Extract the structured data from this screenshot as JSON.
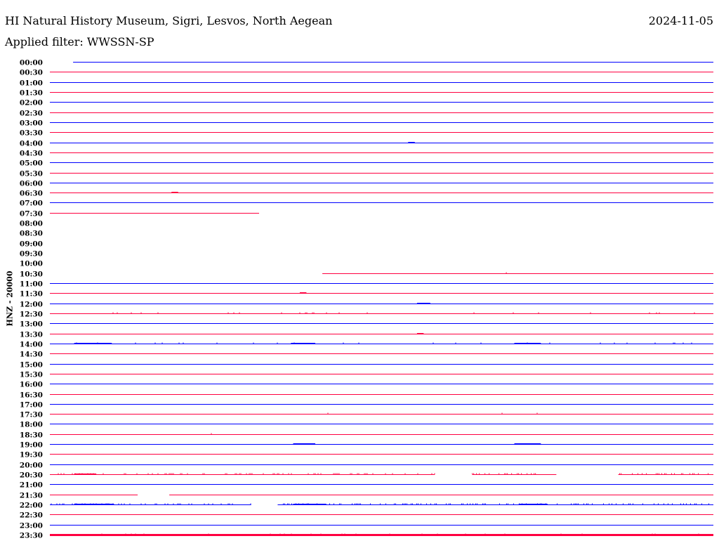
{
  "header": {
    "title": "HI Natural History Museum, Sigri, Lesvos, North Aegean",
    "date": "2024-11-05",
    "filter": "Applied filter: WWSSN-SP"
  },
  "chart_data": {
    "type": "line",
    "title": "HI Natural History Museum, Sigri, Lesvos, North Aegean",
    "ylabel": "HNZ - 20000",
    "x_range_minutes": [
      0,
      30
    ],
    "colors": {
      "even": "#0000ff",
      "odd": "#ff0040"
    },
    "rows": [
      {
        "label": "00:00",
        "segments": [
          [
            1.05,
            30
          ]
        ],
        "noise": 0
      },
      {
        "label": "00:30",
        "segments": [
          [
            0,
            30
          ]
        ],
        "noise": 0
      },
      {
        "label": "01:00",
        "segments": [
          [
            0,
            30
          ]
        ],
        "noise": 0
      },
      {
        "label": "01:30",
        "segments": [
          [
            0,
            30
          ]
        ],
        "noise": 0
      },
      {
        "label": "02:00",
        "segments": [
          [
            0,
            30
          ]
        ],
        "noise": 0
      },
      {
        "label": "02:30",
        "segments": [
          [
            0,
            30
          ]
        ],
        "noise": 0
      },
      {
        "label": "03:00",
        "segments": [
          [
            0,
            30
          ]
        ],
        "noise": 0
      },
      {
        "label": "03:30",
        "segments": [
          [
            0,
            30
          ]
        ],
        "noise": 0
      },
      {
        "label": "04:00",
        "segments": [
          [
            0,
            30
          ]
        ],
        "noise": 0,
        "bursts": [
          [
            16.2,
            16.5
          ]
        ]
      },
      {
        "label": "04:30",
        "segments": [
          [
            0,
            30
          ]
        ],
        "noise": 0
      },
      {
        "label": "05:00",
        "segments": [
          [
            0,
            30
          ]
        ],
        "noise": 0
      },
      {
        "label": "05:30",
        "segments": [
          [
            0,
            30
          ]
        ],
        "noise": 0
      },
      {
        "label": "06:00",
        "segments": [
          [
            0,
            30
          ]
        ],
        "noise": 0
      },
      {
        "label": "06:30",
        "segments": [
          [
            0,
            30
          ]
        ],
        "noise": 0,
        "bursts": [
          [
            5.5,
            5.8
          ]
        ]
      },
      {
        "label": "07:00",
        "segments": [
          [
            0,
            30
          ]
        ],
        "noise": 0
      },
      {
        "label": "07:30",
        "segments": [
          [
            0,
            9.46
          ]
        ],
        "noise": 0
      },
      {
        "label": "08:00",
        "segments": [],
        "noise": 0
      },
      {
        "label": "08:30",
        "segments": [],
        "noise": 0
      },
      {
        "label": "09:00",
        "segments": [],
        "noise": 0
      },
      {
        "label": "09:30",
        "segments": [],
        "noise": 0
      },
      {
        "label": "10:00",
        "segments": [],
        "noise": 0
      },
      {
        "label": "10:30",
        "segments": [
          [
            12.32,
            30
          ]
        ],
        "noise": 0.002
      },
      {
        "label": "11:00",
        "segments": [
          [
            0,
            30
          ]
        ],
        "noise": 0
      },
      {
        "label": "11:30",
        "segments": [
          [
            0,
            30
          ]
        ],
        "noise": 0,
        "bursts": [
          [
            11.3,
            11.6
          ]
        ]
      },
      {
        "label": "12:00",
        "segments": [
          [
            0,
            30
          ]
        ],
        "noise": 0,
        "bursts": [
          [
            16.6,
            17.2
          ]
        ]
      },
      {
        "label": "12:30",
        "segments": [
          [
            0,
            30
          ]
        ],
        "noise": 0.04
      },
      {
        "label": "13:00",
        "segments": [
          [
            0,
            30
          ]
        ],
        "noise": 0
      },
      {
        "label": "13:30",
        "segments": [
          [
            0,
            30
          ]
        ],
        "noise": 0,
        "bursts": [
          [
            16.6,
            16.9
          ]
        ]
      },
      {
        "label": "14:00",
        "segments": [
          [
            0,
            30
          ]
        ],
        "noise": 0.03,
        "bursts": [
          [
            1.1,
            2.8
          ],
          [
            10.9,
            12
          ],
          [
            21,
            22.2
          ]
        ]
      },
      {
        "label": "14:30",
        "segments": [
          [
            0,
            30
          ]
        ],
        "noise": 0
      },
      {
        "label": "15:00",
        "segments": [
          [
            0,
            30
          ]
        ],
        "noise": 0
      },
      {
        "label": "15:30",
        "segments": [
          [
            0,
            30
          ]
        ],
        "noise": 0
      },
      {
        "label": "16:00",
        "segments": [
          [
            0,
            30
          ]
        ],
        "noise": 0
      },
      {
        "label": "16:30",
        "segments": [
          [
            0,
            30
          ]
        ],
        "noise": 0
      },
      {
        "label": "17:00",
        "segments": [
          [
            0,
            30
          ]
        ],
        "noise": 0
      },
      {
        "label": "17:30",
        "segments": [
          [
            0,
            30
          ]
        ],
        "noise": 0.005
      },
      {
        "label": "18:00",
        "segments": [
          [
            0,
            30
          ]
        ],
        "noise": 0
      },
      {
        "label": "18:30",
        "segments": [
          [
            0,
            30
          ]
        ],
        "noise": 0.002
      },
      {
        "label": "19:00",
        "segments": [
          [
            0,
            30
          ]
        ],
        "noise": 0.003,
        "bursts": [
          [
            11,
            12
          ],
          [
            21,
            22.2
          ]
        ]
      },
      {
        "label": "19:30",
        "segments": [
          [
            0,
            30
          ]
        ],
        "noise": 0
      },
      {
        "label": "20:00",
        "segments": [
          [
            0,
            30
          ]
        ],
        "noise": 0
      },
      {
        "label": "20:30",
        "segments": [
          [
            0,
            17.4
          ],
          [
            19.1,
            22.9
          ],
          [
            25.7,
            30
          ]
        ],
        "noise": 0.25,
        "bursts": [
          [
            1.1,
            2.1
          ]
        ]
      },
      {
        "label": "21:00",
        "segments": [
          [
            0,
            30
          ]
        ],
        "noise": 0
      },
      {
        "label": "21:30",
        "segments": [
          [
            0,
            3.97
          ],
          [
            5.4,
            30
          ]
        ],
        "noise": 0
      },
      {
        "label": "22:00",
        "segments": [
          [
            0,
            9.1
          ],
          [
            10.3,
            30
          ]
        ],
        "noise": 0.3,
        "bursts": [
          [
            1.1,
            2.9
          ],
          [
            11,
            12.5
          ],
          [
            21.2,
            22.5
          ]
        ]
      },
      {
        "label": "22:30",
        "segments": [
          [
            0,
            30
          ]
        ],
        "noise": 0
      },
      {
        "label": "23:00",
        "segments": [
          [
            0,
            30
          ]
        ],
        "noise": 0
      },
      {
        "label": "23:30",
        "segments": [
          [
            0,
            30
          ]
        ],
        "noise": 0.05,
        "thick": true
      }
    ]
  }
}
